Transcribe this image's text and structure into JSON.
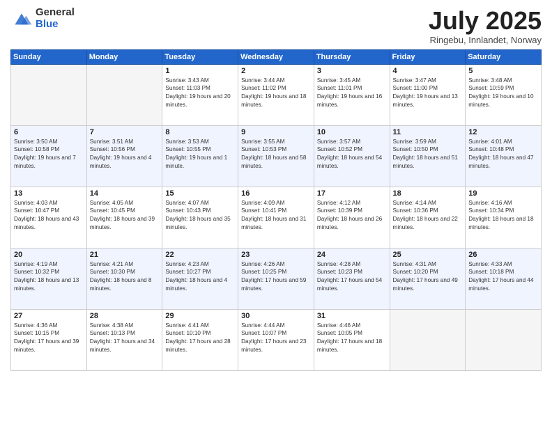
{
  "logo": {
    "general": "General",
    "blue": "Blue"
  },
  "title": "July 2025",
  "subtitle": "Ringebu, Innlandet, Norway",
  "weekdays": [
    "Sunday",
    "Monday",
    "Tuesday",
    "Wednesday",
    "Thursday",
    "Friday",
    "Saturday"
  ],
  "weeks": [
    [
      {
        "day": "",
        "sunrise": "",
        "sunset": "",
        "daylight": ""
      },
      {
        "day": "",
        "sunrise": "",
        "sunset": "",
        "daylight": ""
      },
      {
        "day": "1",
        "sunrise": "Sunrise: 3:43 AM",
        "sunset": "Sunset: 11:03 PM",
        "daylight": "Daylight: 19 hours and 20 minutes."
      },
      {
        "day": "2",
        "sunrise": "Sunrise: 3:44 AM",
        "sunset": "Sunset: 11:02 PM",
        "daylight": "Daylight: 19 hours and 18 minutes."
      },
      {
        "day": "3",
        "sunrise": "Sunrise: 3:45 AM",
        "sunset": "Sunset: 11:01 PM",
        "daylight": "Daylight: 19 hours and 16 minutes."
      },
      {
        "day": "4",
        "sunrise": "Sunrise: 3:47 AM",
        "sunset": "Sunset: 11:00 PM",
        "daylight": "Daylight: 19 hours and 13 minutes."
      },
      {
        "day": "5",
        "sunrise": "Sunrise: 3:48 AM",
        "sunset": "Sunset: 10:59 PM",
        "daylight": "Daylight: 19 hours and 10 minutes."
      }
    ],
    [
      {
        "day": "6",
        "sunrise": "Sunrise: 3:50 AM",
        "sunset": "Sunset: 10:58 PM",
        "daylight": "Daylight: 19 hours and 7 minutes."
      },
      {
        "day": "7",
        "sunrise": "Sunrise: 3:51 AM",
        "sunset": "Sunset: 10:56 PM",
        "daylight": "Daylight: 19 hours and 4 minutes."
      },
      {
        "day": "8",
        "sunrise": "Sunrise: 3:53 AM",
        "sunset": "Sunset: 10:55 PM",
        "daylight": "Daylight: 19 hours and 1 minute."
      },
      {
        "day": "9",
        "sunrise": "Sunrise: 3:55 AM",
        "sunset": "Sunset: 10:53 PM",
        "daylight": "Daylight: 18 hours and 58 minutes."
      },
      {
        "day": "10",
        "sunrise": "Sunrise: 3:57 AM",
        "sunset": "Sunset: 10:52 PM",
        "daylight": "Daylight: 18 hours and 54 minutes."
      },
      {
        "day": "11",
        "sunrise": "Sunrise: 3:59 AM",
        "sunset": "Sunset: 10:50 PM",
        "daylight": "Daylight: 18 hours and 51 minutes."
      },
      {
        "day": "12",
        "sunrise": "Sunrise: 4:01 AM",
        "sunset": "Sunset: 10:48 PM",
        "daylight": "Daylight: 18 hours and 47 minutes."
      }
    ],
    [
      {
        "day": "13",
        "sunrise": "Sunrise: 4:03 AM",
        "sunset": "Sunset: 10:47 PM",
        "daylight": "Daylight: 18 hours and 43 minutes."
      },
      {
        "day": "14",
        "sunrise": "Sunrise: 4:05 AM",
        "sunset": "Sunset: 10:45 PM",
        "daylight": "Daylight: 18 hours and 39 minutes."
      },
      {
        "day": "15",
        "sunrise": "Sunrise: 4:07 AM",
        "sunset": "Sunset: 10:43 PM",
        "daylight": "Daylight: 18 hours and 35 minutes."
      },
      {
        "day": "16",
        "sunrise": "Sunrise: 4:09 AM",
        "sunset": "Sunset: 10:41 PM",
        "daylight": "Daylight: 18 hours and 31 minutes."
      },
      {
        "day": "17",
        "sunrise": "Sunrise: 4:12 AM",
        "sunset": "Sunset: 10:39 PM",
        "daylight": "Daylight: 18 hours and 26 minutes."
      },
      {
        "day": "18",
        "sunrise": "Sunrise: 4:14 AM",
        "sunset": "Sunset: 10:36 PM",
        "daylight": "Daylight: 18 hours and 22 minutes."
      },
      {
        "day": "19",
        "sunrise": "Sunrise: 4:16 AM",
        "sunset": "Sunset: 10:34 PM",
        "daylight": "Daylight: 18 hours and 18 minutes."
      }
    ],
    [
      {
        "day": "20",
        "sunrise": "Sunrise: 4:19 AM",
        "sunset": "Sunset: 10:32 PM",
        "daylight": "Daylight: 18 hours and 13 minutes."
      },
      {
        "day": "21",
        "sunrise": "Sunrise: 4:21 AM",
        "sunset": "Sunset: 10:30 PM",
        "daylight": "Daylight: 18 hours and 8 minutes."
      },
      {
        "day": "22",
        "sunrise": "Sunrise: 4:23 AM",
        "sunset": "Sunset: 10:27 PM",
        "daylight": "Daylight: 18 hours and 4 minutes."
      },
      {
        "day": "23",
        "sunrise": "Sunrise: 4:26 AM",
        "sunset": "Sunset: 10:25 PM",
        "daylight": "Daylight: 17 hours and 59 minutes."
      },
      {
        "day": "24",
        "sunrise": "Sunrise: 4:28 AM",
        "sunset": "Sunset: 10:23 PM",
        "daylight": "Daylight: 17 hours and 54 minutes."
      },
      {
        "day": "25",
        "sunrise": "Sunrise: 4:31 AM",
        "sunset": "Sunset: 10:20 PM",
        "daylight": "Daylight: 17 hours and 49 minutes."
      },
      {
        "day": "26",
        "sunrise": "Sunrise: 4:33 AM",
        "sunset": "Sunset: 10:18 PM",
        "daylight": "Daylight: 17 hours and 44 minutes."
      }
    ],
    [
      {
        "day": "27",
        "sunrise": "Sunrise: 4:36 AM",
        "sunset": "Sunset: 10:15 PM",
        "daylight": "Daylight: 17 hours and 39 minutes."
      },
      {
        "day": "28",
        "sunrise": "Sunrise: 4:38 AM",
        "sunset": "Sunset: 10:13 PM",
        "daylight": "Daylight: 17 hours and 34 minutes."
      },
      {
        "day": "29",
        "sunrise": "Sunrise: 4:41 AM",
        "sunset": "Sunset: 10:10 PM",
        "daylight": "Daylight: 17 hours and 28 minutes."
      },
      {
        "day": "30",
        "sunrise": "Sunrise: 4:44 AM",
        "sunset": "Sunset: 10:07 PM",
        "daylight": "Daylight: 17 hours and 23 minutes."
      },
      {
        "day": "31",
        "sunrise": "Sunrise: 4:46 AM",
        "sunset": "Sunset: 10:05 PM",
        "daylight": "Daylight: 17 hours and 18 minutes."
      },
      {
        "day": "",
        "sunrise": "",
        "sunset": "",
        "daylight": ""
      },
      {
        "day": "",
        "sunrise": "",
        "sunset": "",
        "daylight": ""
      }
    ]
  ]
}
